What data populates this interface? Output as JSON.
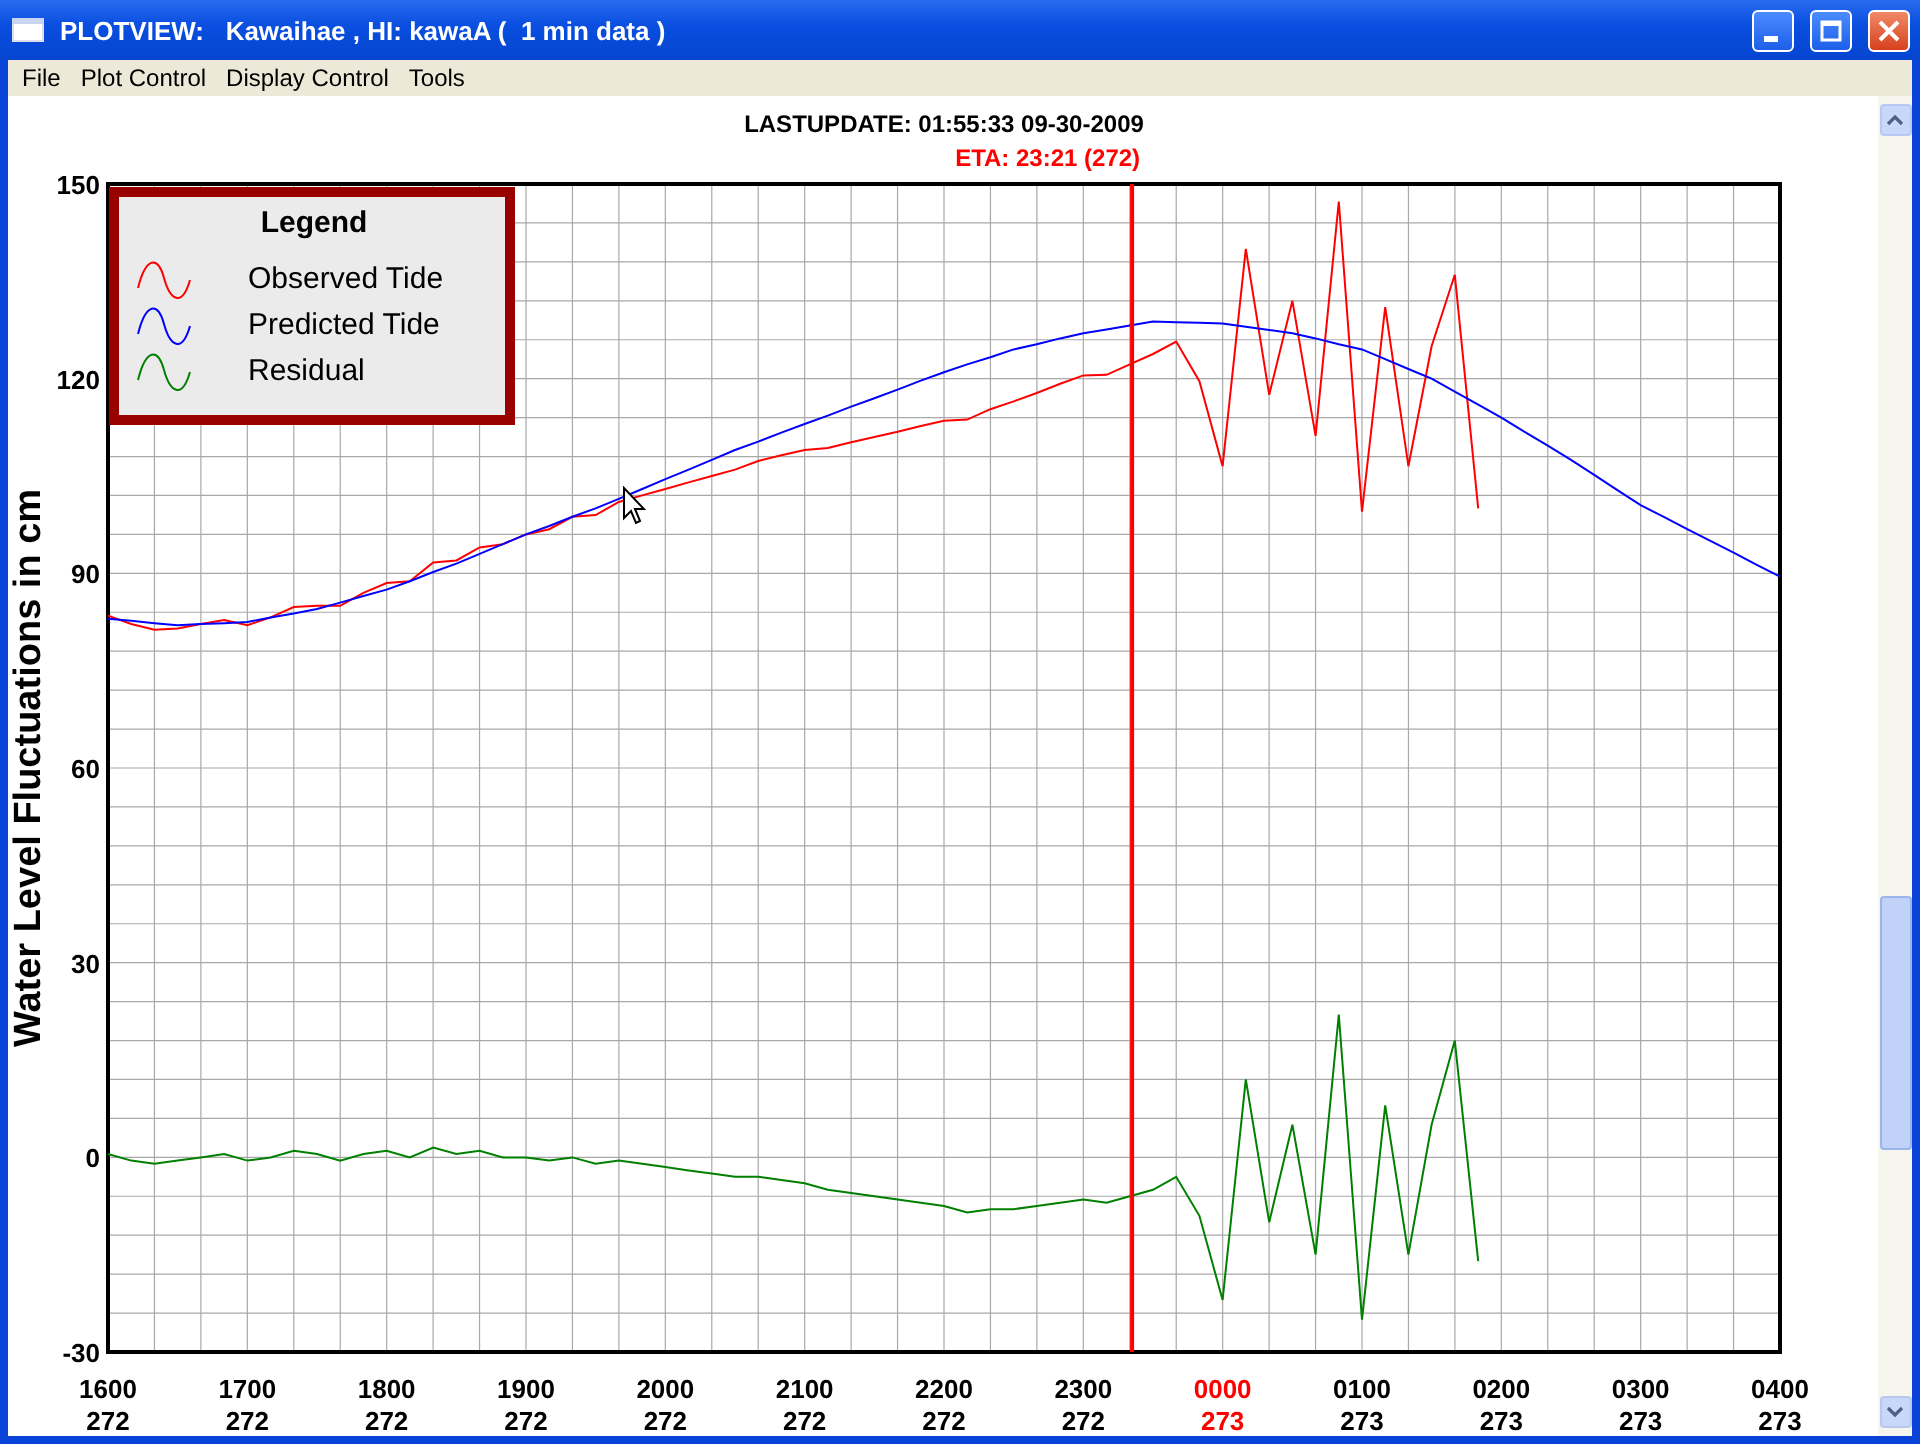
{
  "window": {
    "title": "PLOTVIEW:   Kawaihae , HI: kawaA (  1 min data )"
  },
  "menu": [
    {
      "label": "File"
    },
    {
      "label": "Plot Control"
    },
    {
      "label": "Display Control"
    },
    {
      "label": "Tools"
    }
  ],
  "plot": {
    "chart_data": {
      "type": "line",
      "title": "LASTUPDATE: 01:55:33  09-30-2009",
      "ylabel": "Water Level Fluctuations in cm",
      "categories": [
        "1600",
        null,
        null,
        null,
        null,
        null,
        "1700",
        null,
        null,
        null,
        null,
        null,
        "1800",
        null,
        null,
        null,
        null,
        null,
        "1900",
        null,
        null,
        null,
        null,
        null,
        "2000",
        null,
        null,
        null,
        null,
        null,
        "2100",
        null,
        null,
        null,
        null,
        null,
        "2200",
        null,
        null,
        null,
        null,
        null,
        "2300",
        null,
        null,
        null,
        null,
        null,
        "0000",
        null,
        null,
        null,
        null,
        null,
        "0100",
        null,
        null,
        null,
        null,
        null,
        "0200",
        null,
        null,
        null,
        null,
        null,
        "0300",
        null,
        null,
        null,
        null,
        null,
        "0400"
      ],
      "series": [
        {
          "name": "Observed Tide",
          "color": "#ff0000",
          "values": [
            83.5,
            82.2,
            81.3,
            81.5,
            82.2,
            82.8,
            82,
            83.2,
            84.8,
            85,
            85,
            87,
            88.5,
            88.8,
            91.7,
            92,
            94,
            94.5,
            96,
            96.8,
            98.7,
            99,
            101,
            102,
            103,
            104,
            105,
            106,
            107.3,
            108.2,
            109,
            109.3,
            110.2,
            111,
            111.8,
            112.7,
            113.5,
            113.7,
            115.3,
            116.5,
            117.8,
            119.2,
            120.5,
            120.6,
            122.2,
            123.8,
            125.7,
            119.6,
            106.5,
            140,
            117.5,
            132,
            111.2,
            147.3,
            99.5,
            131,
            106.5,
            125,
            136,
            100,
            null,
            null,
            null,
            null,
            null,
            null,
            null,
            null,
            null,
            null,
            null,
            null,
            null
          ]
        },
        {
          "name": "Predicted Tide",
          "color": "#0000ff",
          "values": [
            83,
            82.7,
            82.3,
            82,
            82.2,
            82.3,
            82.5,
            83.2,
            83.8,
            84.5,
            85.5,
            86.5,
            87.5,
            88.8,
            90.2,
            91.5,
            93,
            94.5,
            96,
            97.3,
            98.7,
            100,
            101.5,
            103,
            104.5,
            106,
            107.5,
            109,
            110.3,
            111.7,
            113,
            114.3,
            115.7,
            117,
            118.3,
            119.7,
            121,
            122.2,
            123.3,
            124.5,
            125.3,
            126.2,
            127,
            127.6,
            128.2,
            128.8,
            128.7,
            128.6,
            128.5,
            128,
            127.5,
            127,
            126.2,
            125.3,
            124.5,
            123,
            121.5,
            120,
            118,
            116,
            114,
            111.8,
            109.7,
            107.5,
            105.2,
            102.8,
            100.5,
            98.7,
            96.8,
            95,
            93.2,
            91.3,
            89.5
          ]
        },
        {
          "name": "Residual",
          "color": "#008000",
          "values": [
            0.5,
            -0.5,
            -1,
            -0.5,
            0,
            0.5,
            -0.5,
            0,
            1,
            0.5,
            -0.5,
            0.5,
            1,
            0,
            1.5,
            0.5,
            1,
            0,
            0,
            -0.5,
            0,
            -1,
            -0.5,
            -1,
            -1.5,
            -2,
            -2.5,
            -3,
            -3,
            -3.5,
            -4,
            -5,
            -5.5,
            -6,
            -6.5,
            -7,
            -7.5,
            -8.5,
            -8,
            -8,
            -7.5,
            -7,
            -6.5,
            -7,
            -6,
            -5,
            -3,
            -9,
            -22,
            12,
            -10,
            5,
            -15,
            22,
            -25,
            8,
            -15,
            5,
            18,
            -16,
            null,
            null,
            null,
            null,
            null,
            null,
            null,
            null,
            null,
            null,
            null,
            null,
            null
          ]
        }
      ],
      "ylim": [
        -30,
        150
      ],
      "yticks": [
        -30,
        0,
        30,
        60,
        90,
        120,
        150
      ],
      "grid": true,
      "legend": true,
      "legend_title": "Legend",
      "annotations": [
        "ETA: 23:21 (272)"
      ]
    },
    "day_labels": [
      {
        "text": "272",
        "color": "#000000"
      },
      {
        "text": "272",
        "color": "#000000"
      },
      {
        "text": "272",
        "color": "#000000"
      },
      {
        "text": "272",
        "color": "#000000"
      },
      {
        "text": "272",
        "color": "#000000"
      },
      {
        "text": "272",
        "color": "#000000"
      },
      {
        "text": "272",
        "color": "#000000"
      },
      {
        "text": "272",
        "color": "#000000"
      },
      {
        "text": "273",
        "color": "#ff0000"
      },
      {
        "text": "273",
        "color": "#000000"
      },
      {
        "text": "273",
        "color": "#000000"
      },
      {
        "text": "273",
        "color": "#000000"
      },
      {
        "text": "273",
        "color": "#000000"
      }
    ]
  }
}
